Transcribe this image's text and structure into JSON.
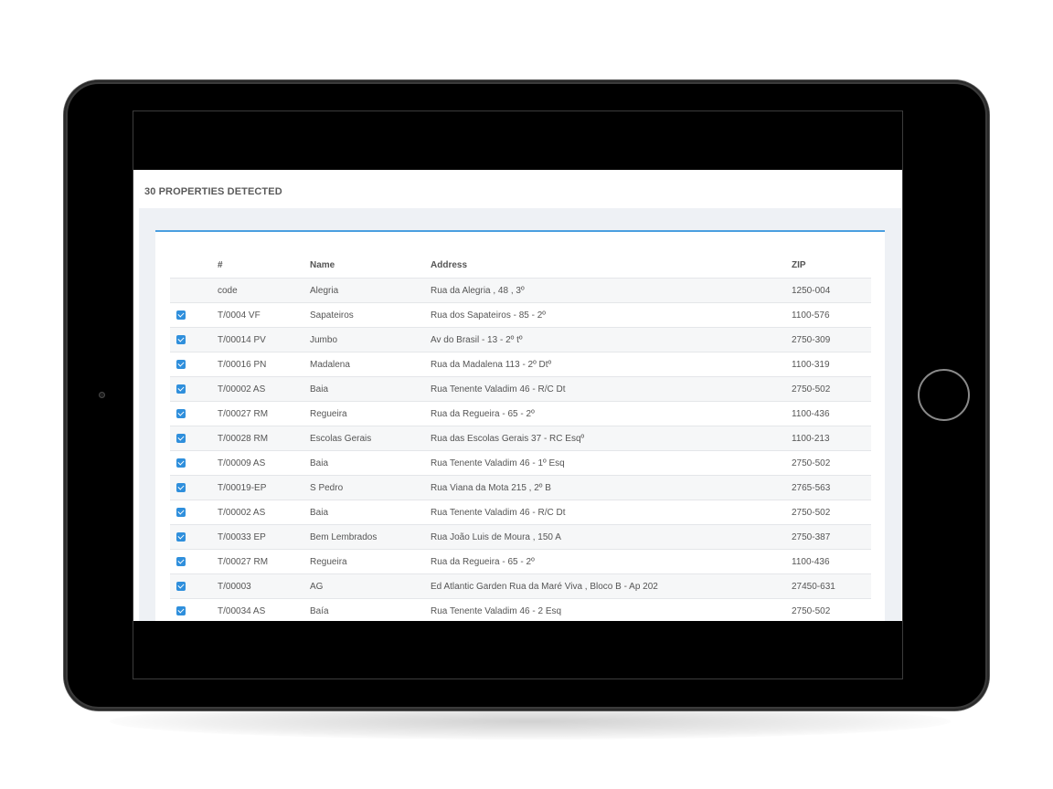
{
  "app": {
    "title": "30 PROPERTIES DETECTED"
  },
  "table": {
    "columns": [
      "#",
      "Name",
      "Address",
      "ZIP"
    ],
    "rows": [
      {
        "checked": false,
        "id": "code",
        "name": "Alegria",
        "address": "Rua da Alegria , 48 , 3º",
        "zip": "1250-004"
      },
      {
        "checked": true,
        "id": "T/0004 VF",
        "name": "Sapateiros",
        "address": "Rua dos Sapateiros - 85 - 2º",
        "zip": "1100-576"
      },
      {
        "checked": true,
        "id": "T/00014 PV",
        "name": "Jumbo",
        "address": "Av do Brasil - 13 - 2º tº",
        "zip": "2750-309"
      },
      {
        "checked": true,
        "id": "T/00016 PN",
        "name": "Madalena",
        "address": "Rua da Madalena 113 - 2º Dtº",
        "zip": "1100-319"
      },
      {
        "checked": true,
        "id": "T/00002 AS",
        "name": "Baia",
        "address": "Rua Tenente Valadim 46 - R/C Dt",
        "zip": "2750-502"
      },
      {
        "checked": true,
        "id": "T/00027 RM",
        "name": "Regueira",
        "address": "Rua da Regueira - 65 - 2º",
        "zip": "1100-436"
      },
      {
        "checked": true,
        "id": "T/00028 RM",
        "name": "Escolas Gerais",
        "address": "Rua das Escolas Gerais 37 - RC Esqº",
        "zip": "1100-213"
      },
      {
        "checked": true,
        "id": "T/00009 AS",
        "name": "Baia",
        "address": "Rua Tenente Valadim 46 - 1º Esq",
        "zip": "2750-502"
      },
      {
        "checked": true,
        "id": "T/00019-EP",
        "name": "S Pedro",
        "address": "Rua Viana da Mota 215 , 2º B",
        "zip": "2765-563"
      },
      {
        "checked": true,
        "id": "T/00002 AS",
        "name": "Baia",
        "address": "Rua Tenente Valadim 46 - R/C Dt",
        "zip": "2750-502"
      },
      {
        "checked": true,
        "id": "T/00033 EP",
        "name": "Bem Lembrados",
        "address": "Rua João Luis de Moura , 150 A",
        "zip": "2750-387"
      },
      {
        "checked": true,
        "id": "T/00027 RM",
        "name": "Regueira",
        "address": "Rua da Regueira - 65 - 2º",
        "zip": "1100-436"
      },
      {
        "checked": true,
        "id": "T/00003",
        "name": "AG",
        "address": "Ed Atlantic Garden Rua da Maré Viva , Bloco B - Ap 202",
        "zip": "27450-631"
      },
      {
        "checked": true,
        "id": "T/00034 AS",
        "name": "Baía",
        "address": "Rua Tenente Valadim 46 - 2 Esq",
        "zip": "2750-502"
      }
    ]
  },
  "colors": {
    "accent": "#2f8fdc",
    "panel_border": "#4a9fe0",
    "device": "#000000"
  }
}
